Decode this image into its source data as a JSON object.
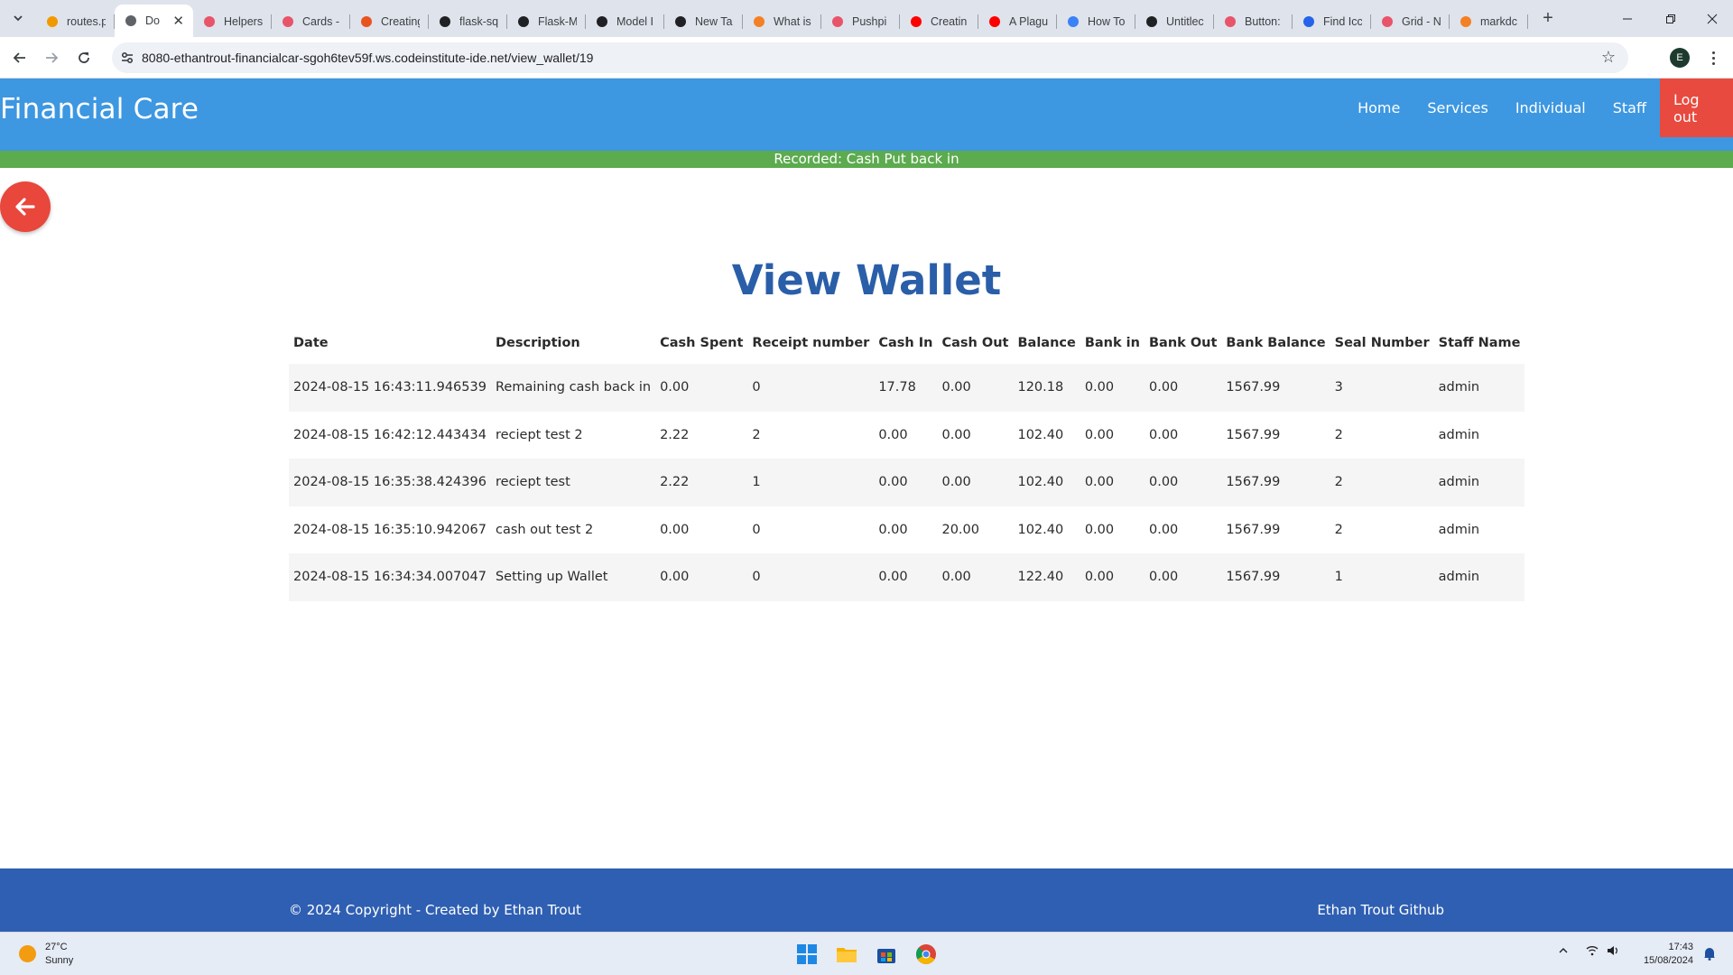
{
  "browser": {
    "tabs": [
      {
        "title": "routes.p",
        "icon": "google-icon",
        "color": "#f29900"
      },
      {
        "title": "Do",
        "icon": "globe-icon",
        "color": "#5f6368",
        "active": true
      },
      {
        "title": "Helpers",
        "icon": "bulma-icon",
        "color": "#e8546a"
      },
      {
        "title": "Cards -",
        "icon": "bulma-icon",
        "color": "#e8546a"
      },
      {
        "title": "Creating",
        "icon": "ring-icon",
        "color": "#e8541f"
      },
      {
        "title": "flask-sq",
        "icon": "github-icon",
        "color": "#202124"
      },
      {
        "title": "Flask-M",
        "icon": "doc-icon",
        "color": "#202124"
      },
      {
        "title": "Model I",
        "icon": "openai-icon",
        "color": "#202124"
      },
      {
        "title": "New Ta",
        "icon": "globe-icon",
        "color": "#202124"
      },
      {
        "title": "What is",
        "icon": "stack-icon",
        "color": "#f48024"
      },
      {
        "title": "Pushpi",
        "icon": "bulma-icon",
        "color": "#e8546a"
      },
      {
        "title": "Creatin",
        "icon": "youtube-icon",
        "color": "#ff0000"
      },
      {
        "title": "A Plagu",
        "icon": "youtube-icon",
        "color": "#ff0000"
      },
      {
        "title": "How To",
        "icon": "swirl-icon",
        "color": "#3b82f6"
      },
      {
        "title": "Untitlec",
        "icon": "d-icon",
        "color": "#202124"
      },
      {
        "title": "Button:",
        "icon": "bulma-icon",
        "color": "#e8546a"
      },
      {
        "title": "Find Icc",
        "icon": "flag-icon",
        "color": "#2563eb"
      },
      {
        "title": "Grid - N",
        "icon": "bulma-icon",
        "color": "#e8546a"
      },
      {
        "title": "markdc",
        "icon": "stack-icon",
        "color": "#f48024"
      }
    ],
    "url": "8080-ethantrout-financialcar-sgoh6tev59f.ws.codeinstitute-ide.net/view_wallet/19",
    "profile_initial": "E"
  },
  "site": {
    "brand": "Financial Care",
    "nav": [
      "Home",
      "Services",
      "Individual",
      "Staff"
    ],
    "logout": "Log out",
    "flash": "Recorded: Cash Put back in",
    "title": "View Wallet",
    "colors": {
      "navbar": "#3d97e1",
      "logout": "#e94a3f",
      "flash": "#5cab4f",
      "title": "#2a5ea8",
      "footer": "#2f5fb2"
    }
  },
  "table": {
    "headers": [
      "Date",
      "Description",
      "Cash Spent",
      "Receipt number",
      "Cash In",
      "Cash Out",
      "Balance",
      "Bank in",
      "Bank Out",
      "Bank Balance",
      "Seal Number",
      "Staff Name"
    ],
    "rows": [
      [
        "2024-08-15 16:43:11.946539",
        "Remaining cash back in",
        "0.00",
        "0",
        "17.78",
        "0.00",
        "120.18",
        "0.00",
        "0.00",
        "1567.99",
        "3",
        "admin"
      ],
      [
        "2024-08-15 16:42:12.443434",
        "reciept test 2",
        "2.22",
        "2",
        "0.00",
        "0.00",
        "102.40",
        "0.00",
        "0.00",
        "1567.99",
        "2",
        "admin"
      ],
      [
        "2024-08-15 16:35:38.424396",
        "reciept test",
        "2.22",
        "1",
        "0.00",
        "0.00",
        "102.40",
        "0.00",
        "0.00",
        "1567.99",
        "2",
        "admin"
      ],
      [
        "2024-08-15 16:35:10.942067",
        "cash out test 2",
        "0.00",
        "0",
        "0.00",
        "20.00",
        "102.40",
        "0.00",
        "0.00",
        "1567.99",
        "2",
        "admin"
      ],
      [
        "2024-08-15 16:34:34.007047",
        "Setting up Wallet",
        "0.00",
        "0",
        "0.00",
        "0.00",
        "122.40",
        "0.00",
        "0.00",
        "1567.99",
        "1",
        "admin"
      ]
    ]
  },
  "footer": {
    "copyright": "© 2024 Copyright - Created by Ethan Trout",
    "github": "Ethan Trout Github"
  },
  "taskbar": {
    "temperature": "27°C",
    "weather": "Sunny",
    "time": "17:43",
    "date": "15/08/2024",
    "apps": [
      "windows-start-icon",
      "file-explorer-icon",
      "microsoft-store-icon",
      "chrome-icon"
    ]
  }
}
